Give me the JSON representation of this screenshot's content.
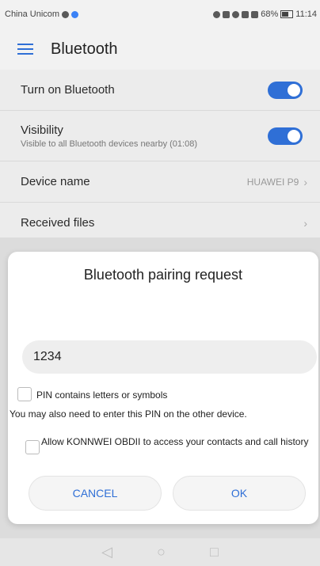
{
  "status_bar": {
    "carrier": "China Unicom",
    "battery": "68%",
    "time": "11:14"
  },
  "app_bar": {
    "title": "Bluetooth"
  },
  "settings": {
    "turn_on": {
      "label": "Turn on Bluetooth",
      "enabled": true
    },
    "visibility": {
      "label": "Visibility",
      "sub": "Visible to all Bluetooth devices nearby (01:08)",
      "enabled": true
    },
    "device_name": {
      "label": "Device name",
      "value": "HUAWEI P9"
    },
    "received_files": {
      "label": "Received files"
    }
  },
  "dialog": {
    "title": "Bluetooth pairing request",
    "pin_value": "1234",
    "pin_letters_label": "PIN contains letters or symbols",
    "note": "You may also need to enter this PIN on the other device.",
    "allow_label": "Allow KONNWEI OBDII to access your contacts and call history",
    "cancel_label": "CANCEL",
    "ok_label": "OK"
  },
  "colors": {
    "accent": "#2f6fd6"
  },
  "icons": {
    "menu": "hamburger-menu-icon",
    "chevron": "chevron-right-icon",
    "nav_back": "back-triangle-icon",
    "nav_home": "home-circle-icon",
    "nav_recent": "recent-square-icon"
  }
}
